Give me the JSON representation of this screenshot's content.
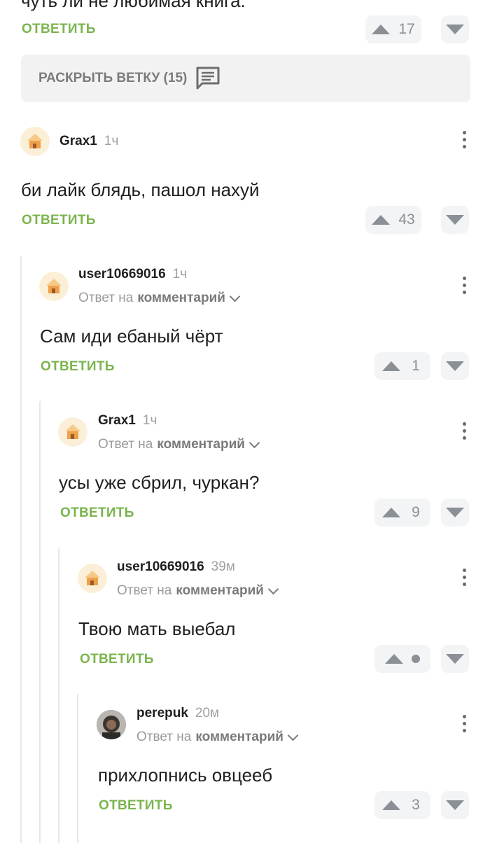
{
  "partial_top_text": "чуть ли не любимая книга.",
  "reply_label": "ОТВЕТИТЬ",
  "top_votes": "17",
  "expand": {
    "label": "РАСКРЫТЬ ВЕТКУ (15)",
    "icon": "comment-icon"
  },
  "comments": [
    {
      "author": "Grax1",
      "time": "1ч",
      "text": "би лайк блядь, пашол нахуй",
      "votes": "43"
    },
    {
      "author": "user10669016",
      "time": "1ч",
      "reply_prefix": "Ответ на",
      "reply_target": "комментарий",
      "text": "Сам иди ебаный чёрт",
      "votes": "1"
    },
    {
      "author": "Grax1",
      "time": "1ч",
      "reply_prefix": "Ответ на",
      "reply_target": "комментарий",
      "text": "усы уже сбрил, чуркан?",
      "votes": "9"
    },
    {
      "author": "user10669016",
      "time": "39м",
      "reply_prefix": "Ответ на",
      "reply_target": "комментарий",
      "text": "Твою мать выебал",
      "votes": ""
    },
    {
      "author": "perepuk",
      "time": "20м",
      "reply_prefix": "Ответ на",
      "reply_target": "комментарий",
      "text": "прихлопнись овцееб",
      "votes": "3"
    }
  ],
  "colors": {
    "accent_green": "#7ab44d",
    "vote_bg": "#f3f4f5",
    "muted": "#9a9a9a"
  }
}
